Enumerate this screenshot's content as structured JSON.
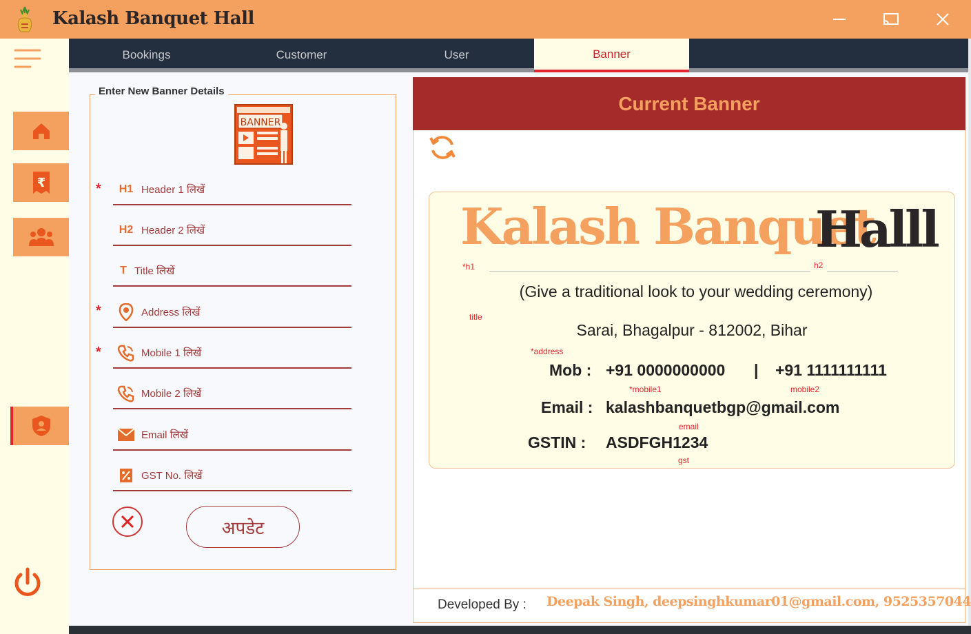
{
  "app": {
    "title": "Kalash Banquet Hall"
  },
  "window_controls": {
    "minimize": "minimize-icon",
    "maximize": "cast-icon",
    "close": "close-icon"
  },
  "tabs": [
    {
      "label": "Bookings"
    },
    {
      "label": "Customer"
    },
    {
      "label": "User"
    },
    {
      "label": "Banner",
      "active": true
    }
  ],
  "sidebar": {
    "items": [
      {
        "icon": "home-icon"
      },
      {
        "icon": "rupee-receipt-icon"
      },
      {
        "icon": "users-icon"
      },
      {
        "icon": "shield-icon",
        "active": true
      }
    ]
  },
  "form": {
    "legend": "Enter New Banner Details",
    "fields": [
      {
        "icon_text": "H1",
        "placeholder": "Header 1 लिखें",
        "required": true
      },
      {
        "icon_text": "H2",
        "placeholder": "Header 2 लिखें",
        "required": false
      },
      {
        "icon_text": "T",
        "placeholder": "Title लिखें",
        "required": false
      },
      {
        "icon": "location-pin-icon",
        "placeholder": "Address लिखें",
        "required": true
      },
      {
        "icon": "phone-icon",
        "placeholder": "Mobile 1 लिखें",
        "required": true
      },
      {
        "icon": "phone-icon",
        "placeholder": "Mobile 2 लिखें",
        "required": false
      },
      {
        "icon": "mail-icon",
        "placeholder": "Email लिखें",
        "required": false
      },
      {
        "icon": "percent-doc-icon",
        "placeholder": "GST No. लिखें",
        "required": false
      }
    ],
    "required_mark": "*",
    "update_label": "अपडेट"
  },
  "preview": {
    "header": "Current Banner",
    "h1": "Kalash Banquet",
    "h2": "Halll",
    "tags": {
      "h1": "*h1",
      "h2": "h2",
      "title": "title",
      "address": "*address",
      "mobile1": "*mobile1",
      "mobile2": "mobile2",
      "email": "email",
      "gst": "gst"
    },
    "title": "(Give a traditional look to your wedding ceremony)",
    "address": "Sarai, Bhagalpur - 812002, Bihar",
    "mob_label": "Mob :",
    "mobile1": "+91 0000000000",
    "separator": "|",
    "mobile2": "+91 1111111111",
    "email_label": "Email :",
    "email": "kalashbanquetbgp@gmail.com",
    "gst_label": "GSTIN :",
    "gst": "ASDFGH1234"
  },
  "footer": {
    "label": "Developed By :",
    "value": "Deepak Singh, deepsinghkumar01@gmail.com, 9525357044"
  },
  "colors": {
    "accent": "#f4a05f",
    "dark": "#232f3e",
    "maroon": "#a52a2a",
    "red": "#e2262f",
    "cream": "#fffde5"
  }
}
